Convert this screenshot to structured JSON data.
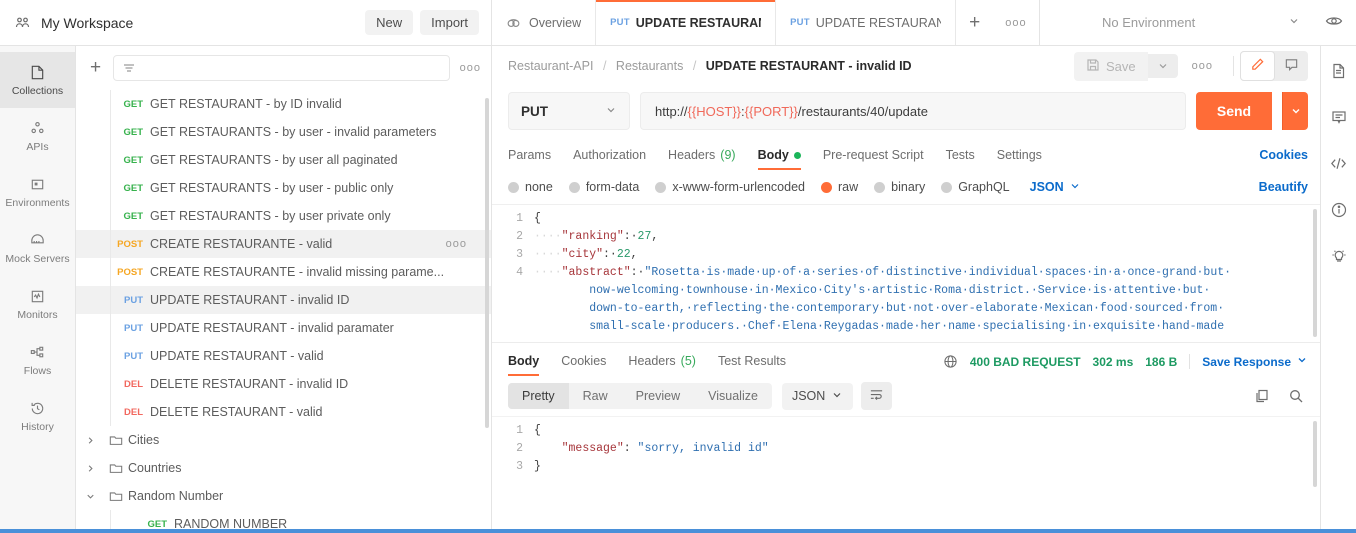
{
  "workspace": {
    "title": "My Workspace",
    "new_label": "New",
    "import_label": "Import"
  },
  "tabs": [
    {
      "label": "Overview",
      "method": "",
      "icon": "overview-icon",
      "active": false
    },
    {
      "label": "UPDATE RESTAURANT -",
      "method": "PUT",
      "active": true
    },
    {
      "label": "UPDATE RESTAURANT -",
      "method": "PUT",
      "active": false
    }
  ],
  "environment": {
    "label": "No Environment"
  },
  "rail": [
    {
      "label": "Collections",
      "icon": "collections-icon",
      "active": true
    },
    {
      "label": "APIs",
      "icon": "apis-icon",
      "active": false
    },
    {
      "label": "Environments",
      "icon": "environments-icon",
      "active": false
    },
    {
      "label": "Mock Servers",
      "icon": "mock-servers-icon",
      "active": false
    },
    {
      "label": "Monitors",
      "icon": "monitors-icon",
      "active": false
    },
    {
      "label": "Flows",
      "icon": "flows-icon",
      "active": false
    },
    {
      "label": "History",
      "icon": "history-icon",
      "active": false
    }
  ],
  "sidebar": {
    "search_placeholder": "",
    "items": [
      {
        "type": "request",
        "method": "GET",
        "label": "GET RESTAURANT - by ID invalid",
        "selected": false
      },
      {
        "type": "request",
        "method": "GET",
        "label": "GET RESTAURANTS - by user - invalid parameters",
        "selected": false
      },
      {
        "type": "request",
        "method": "GET",
        "label": "GET RESTAURANTS - by user all paginated",
        "selected": false
      },
      {
        "type": "request",
        "method": "GET",
        "label": "GET RESTAURANTS - by user - public only",
        "selected": false
      },
      {
        "type": "request",
        "method": "GET",
        "label": "GET RESTAURANTS - by user private only",
        "selected": false
      },
      {
        "type": "request",
        "method": "POST",
        "label": "CREATE RESTAURANTE - valid",
        "selected": true,
        "dots": true
      },
      {
        "type": "request",
        "method": "POST",
        "label": "CREATE RESTAURANTE - invalid missing parame...",
        "selected": false
      },
      {
        "type": "request",
        "method": "PUT",
        "label": "UPDATE RESTAURANT - invalid ID",
        "selected": true
      },
      {
        "type": "request",
        "method": "PUT",
        "label": "UPDATE RESTAURANT - invalid paramater",
        "selected": false
      },
      {
        "type": "request",
        "method": "PUT",
        "label": "UPDATE RESTAURANT - valid",
        "selected": false
      },
      {
        "type": "request",
        "method": "DEL",
        "label": "DELETE RESTAURANT - invalid ID",
        "selected": false
      },
      {
        "type": "request",
        "method": "DEL",
        "label": "DELETE RESTAURANT - valid",
        "selected": false
      },
      {
        "type": "folder",
        "expanded": false,
        "label": "Cities"
      },
      {
        "type": "folder",
        "expanded": false,
        "label": "Countries"
      },
      {
        "type": "folder",
        "expanded": true,
        "label": "Random Number"
      },
      {
        "type": "request",
        "method": "GET",
        "label": "RANDOM NUMBER",
        "selected": false,
        "indent": true
      }
    ]
  },
  "breadcrumb": {
    "parts": [
      "Restaurant-API",
      "Restaurants"
    ],
    "current": "UPDATE RESTAURANT - invalid ID"
  },
  "actions": {
    "save_label": "Save"
  },
  "request": {
    "method": "PUT",
    "url_prefix": "http://",
    "url_host_var": "{{HOST}}",
    "url_colon": ":",
    "url_port_var": "{{PORT}}",
    "url_path": "/restaurants/40/update",
    "send_label": "Send",
    "tabs": [
      {
        "label": "Params",
        "active": false
      },
      {
        "label": "Authorization",
        "active": false
      },
      {
        "label": "Headers",
        "count": "(9)",
        "active": false
      },
      {
        "label": "Body",
        "active": true,
        "dot": true
      },
      {
        "label": "Pre-request Script",
        "active": false
      },
      {
        "label": "Tests",
        "active": false
      },
      {
        "label": "Settings",
        "active": false
      }
    ],
    "cookies_label": "Cookies",
    "body_types": [
      {
        "label": "none",
        "on": false
      },
      {
        "label": "form-data",
        "on": false
      },
      {
        "label": "x-www-form-urlencoded",
        "on": false
      },
      {
        "label": "raw",
        "on": true
      },
      {
        "label": "binary",
        "on": false
      },
      {
        "label": "GraphQL",
        "on": false
      }
    ],
    "format": "JSON",
    "beautify_label": "Beautify",
    "body_lines": [
      {
        "n": "1",
        "segs": [
          {
            "t": "{",
            "c": "p"
          }
        ]
      },
      {
        "n": "2",
        "segs": [
          {
            "t": "····",
            "c": "dots"
          },
          {
            "t": "\"ranking\"",
            "c": "k"
          },
          {
            "t": ":·",
            "c": "p"
          },
          {
            "t": "27",
            "c": "num"
          },
          {
            "t": ",",
            "c": "p"
          }
        ]
      },
      {
        "n": "3",
        "segs": [
          {
            "t": "····",
            "c": "dots"
          },
          {
            "t": "\"city\"",
            "c": "k"
          },
          {
            "t": ":·",
            "c": "p"
          },
          {
            "t": "22",
            "c": "num"
          },
          {
            "t": ",",
            "c": "p"
          }
        ]
      },
      {
        "n": "4",
        "segs": [
          {
            "t": "····",
            "c": "dots"
          },
          {
            "t": "\"abstract\"",
            "c": "k"
          },
          {
            "t": ":·",
            "c": "p"
          },
          {
            "t": "\"Rosetta·is·made·up·of·a·series·of·distinctive·individual·spaces·in·a·once-grand·but·",
            "c": "rstr"
          }
        ]
      },
      {
        "n": "",
        "segs": [
          {
            "t": "        now-welcoming·townhouse·in·Mexico·City's·artistic·Roma·district.·Service·is·attentive·but·",
            "c": "rstr"
          }
        ]
      },
      {
        "n": "",
        "segs": [
          {
            "t": "        down-to-earth,·reflecting·the·contemporary·but·not·over-elaborate·Mexican·food·sourced·from·",
            "c": "rstr"
          }
        ]
      },
      {
        "n": "",
        "segs": [
          {
            "t": "        small-scale·producers.·Chef·Elena·Reygadas·made·her·name·specialising·in·exquisite·hand-made",
            "c": "rstr"
          }
        ]
      }
    ]
  },
  "response": {
    "tabs": [
      {
        "label": "Body",
        "active": true
      },
      {
        "label": "Cookies",
        "active": false
      },
      {
        "label": "Headers",
        "count": "(5)",
        "active": false
      },
      {
        "label": "Test Results",
        "active": false
      }
    ],
    "status": "400 BAD REQUEST",
    "time": "302 ms",
    "size": "186 B",
    "save_response_label": "Save Response",
    "view_modes": [
      {
        "label": "Pretty",
        "on": true
      },
      {
        "label": "Raw",
        "on": false
      },
      {
        "label": "Preview",
        "on": false
      },
      {
        "label": "Visualize",
        "on": false
      }
    ],
    "format": "JSON",
    "body_lines": [
      {
        "n": "1",
        "segs": [
          {
            "t": "{",
            "c": "p"
          }
        ]
      },
      {
        "n": "2",
        "segs": [
          {
            "t": "    ",
            "c": "p"
          },
          {
            "t": "\"message\"",
            "c": "k"
          },
          {
            "t": ": ",
            "c": "p"
          },
          {
            "t": "\"sorry, invalid id\"",
            "c": "rstr"
          }
        ]
      },
      {
        "n": "3",
        "segs": [
          {
            "t": "}",
            "c": "p"
          }
        ]
      }
    ]
  },
  "right_rail": [
    {
      "icon": "documentation-icon"
    },
    {
      "icon": "comment-icon"
    },
    {
      "icon": "code-icon"
    },
    {
      "icon": "info-icon"
    },
    {
      "icon": "lightbulb-icon"
    }
  ],
  "colors": {
    "accent": "#ff6c37",
    "link": "#0b6bcb",
    "status_ok": "#1d9a62"
  }
}
